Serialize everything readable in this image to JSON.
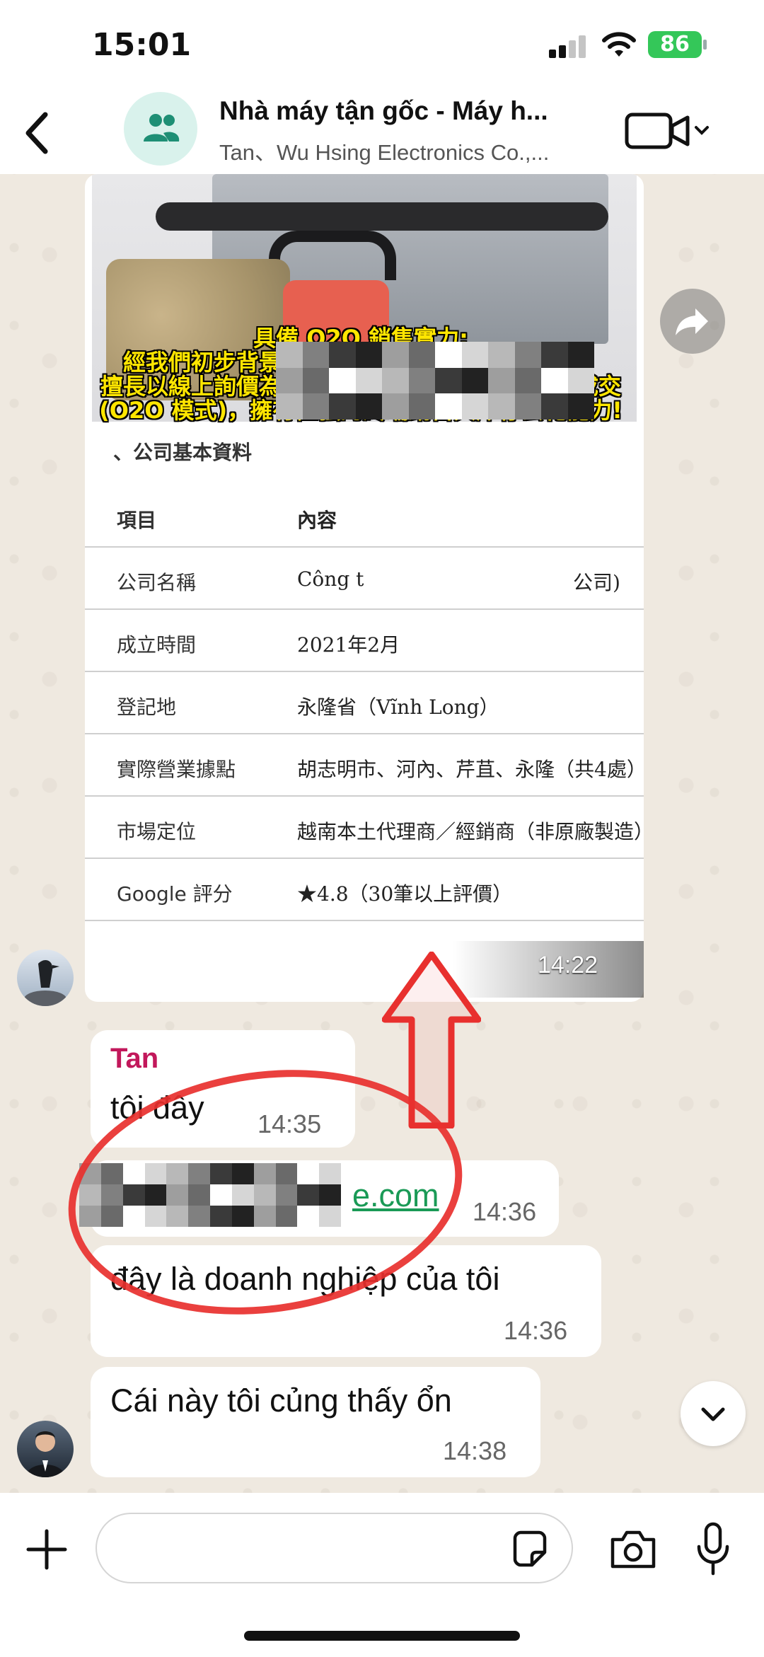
{
  "status_bar": {
    "time": "15:01",
    "battery": "86"
  },
  "header": {
    "title": "Nhà máy tận gốc - Máy h...",
    "subtitle": "Tan、Wu Hsing Electronics Co.,..."
  },
  "image_card": {
    "caption_lines": [
      "具備 O2O 銷售實力:",
      "經我們初步背景調查，該客戶專營高單價機台，",
      "擅長以線上詢價為勾子，引導至線下實體店體驗成交",
      "(O2O 模式)，擁有極強的終端銷售與庫存去化能力!"
    ],
    "section_title": "、公司基本資料",
    "table_header": {
      "key": "項目",
      "value": "內容"
    },
    "rows": [
      {
        "key": "公司名稱",
        "value": "Công t",
        "value_tail": "公司)"
      },
      {
        "key": "成立時間",
        "value": "2021年2月"
      },
      {
        "key": "登記地",
        "value": "永隆省（Vĩnh Long）"
      },
      {
        "key": "實際營業據點",
        "value": "胡志明市、河內、芹苴、永隆（共4處）"
      },
      {
        "key": "市場定位",
        "value": "越南本土代理商／經銷商（非原廠製造）"
      },
      {
        "key": "Google 評分",
        "value": "★4.8（30筆以上評價）"
      }
    ],
    "time": "14:22"
  },
  "messages": [
    {
      "sender": "Tan",
      "text": "tôi đây",
      "time": "14:35"
    },
    {
      "link_suffix": "e.com",
      "time": "14:36"
    },
    {
      "text": "đây là doanh nghiệp của tôi",
      "time": "14:36"
    },
    {
      "text": "Cái này tôi củng thấy ổn",
      "time": "14:38"
    }
  ],
  "input": {
    "placeholder": ""
  },
  "colors": {
    "accent": "#34c759",
    "sender": "#c2185b",
    "link": "#1a9a56",
    "annotation": "#e8302e",
    "caption": "#ffe600"
  },
  "icons": [
    "back-icon",
    "group-icon",
    "video-call-icon",
    "forward-icon",
    "scroll-down-icon",
    "plus-icon",
    "sticker-icon",
    "camera-icon",
    "mic-icon"
  ]
}
